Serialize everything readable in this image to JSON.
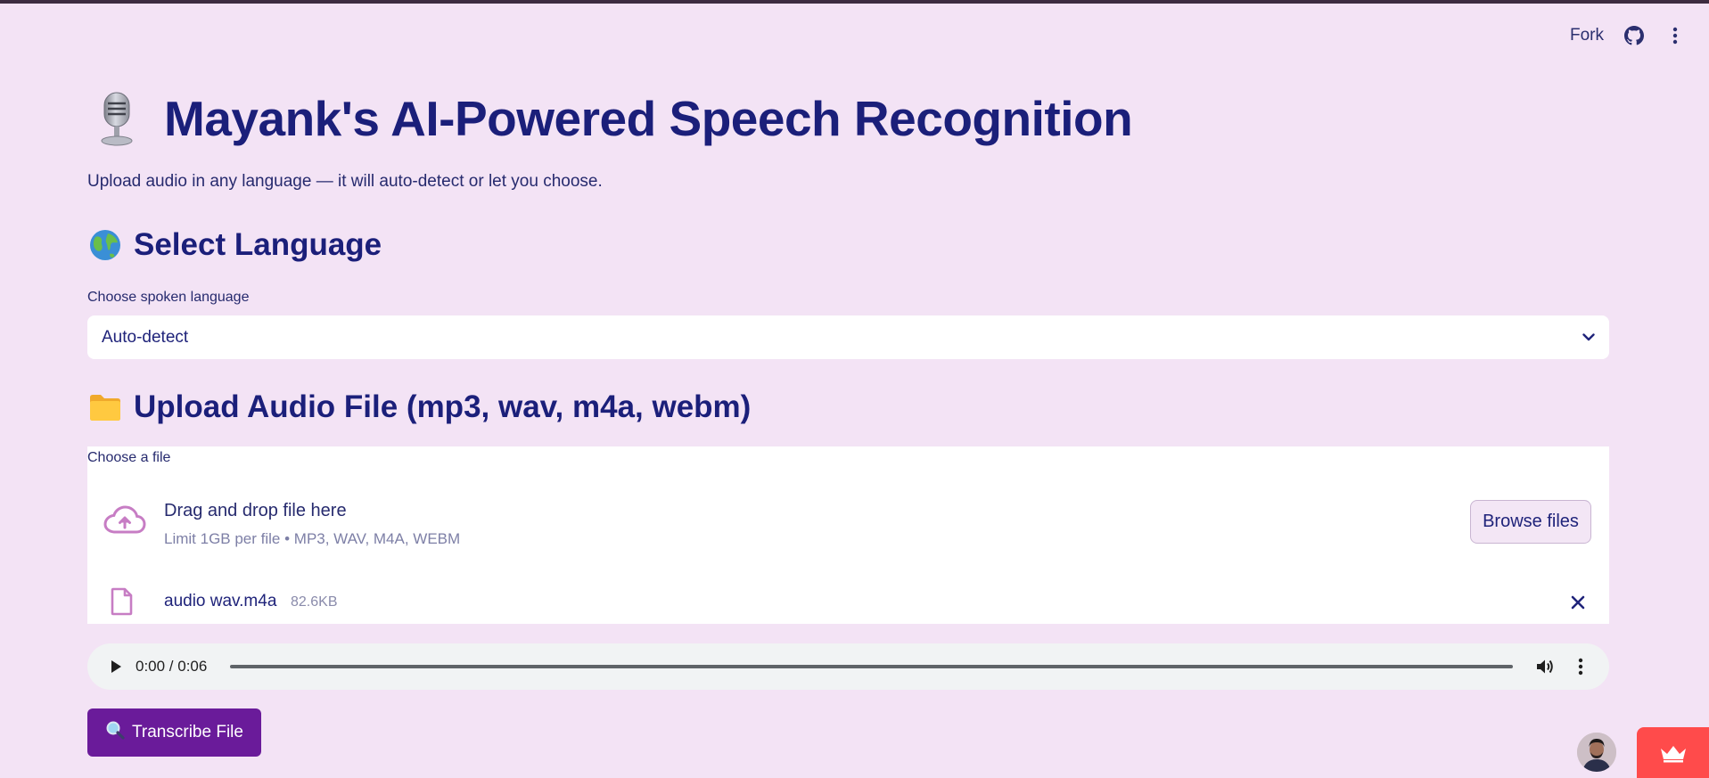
{
  "header": {
    "fork_label": "Fork",
    "icons": {
      "github": "github-icon",
      "menu": "more-vertical-icon"
    }
  },
  "main": {
    "title": "Mayank's AI-Powered Speech Recognition",
    "title_icon": "microphone-icon",
    "subtitle": "Upload audio in any language — it will auto-detect or let you choose."
  },
  "language_section": {
    "heading": "Select Language",
    "icon": "globe-icon",
    "field_label": "Choose spoken language",
    "selected_value": "Auto-detect"
  },
  "upload_section": {
    "heading": "Upload Audio File (mp3, wav, m4a, webm)",
    "icon": "folder-icon",
    "field_label": "Choose a file",
    "dropzone_title": "Drag and drop file here",
    "dropzone_limit": "Limit 1GB per file • MP3, WAV, M4A, WEBM",
    "browse_label": "Browse files",
    "file": {
      "name": "audio wav.m4a",
      "size": "82.6KB"
    }
  },
  "audio_player": {
    "time": "0:00 / 0:06",
    "progress": 0
  },
  "transcribe_button": {
    "label": "Transcribe File",
    "icon": "magnifier-icon"
  },
  "colors": {
    "page_bg": "#f3e3f5",
    "heading": "#1b1f7a",
    "primary_button": "#6a1b9a",
    "upload_icon": "#c77dc4",
    "badge": "#ff4b4b"
  }
}
